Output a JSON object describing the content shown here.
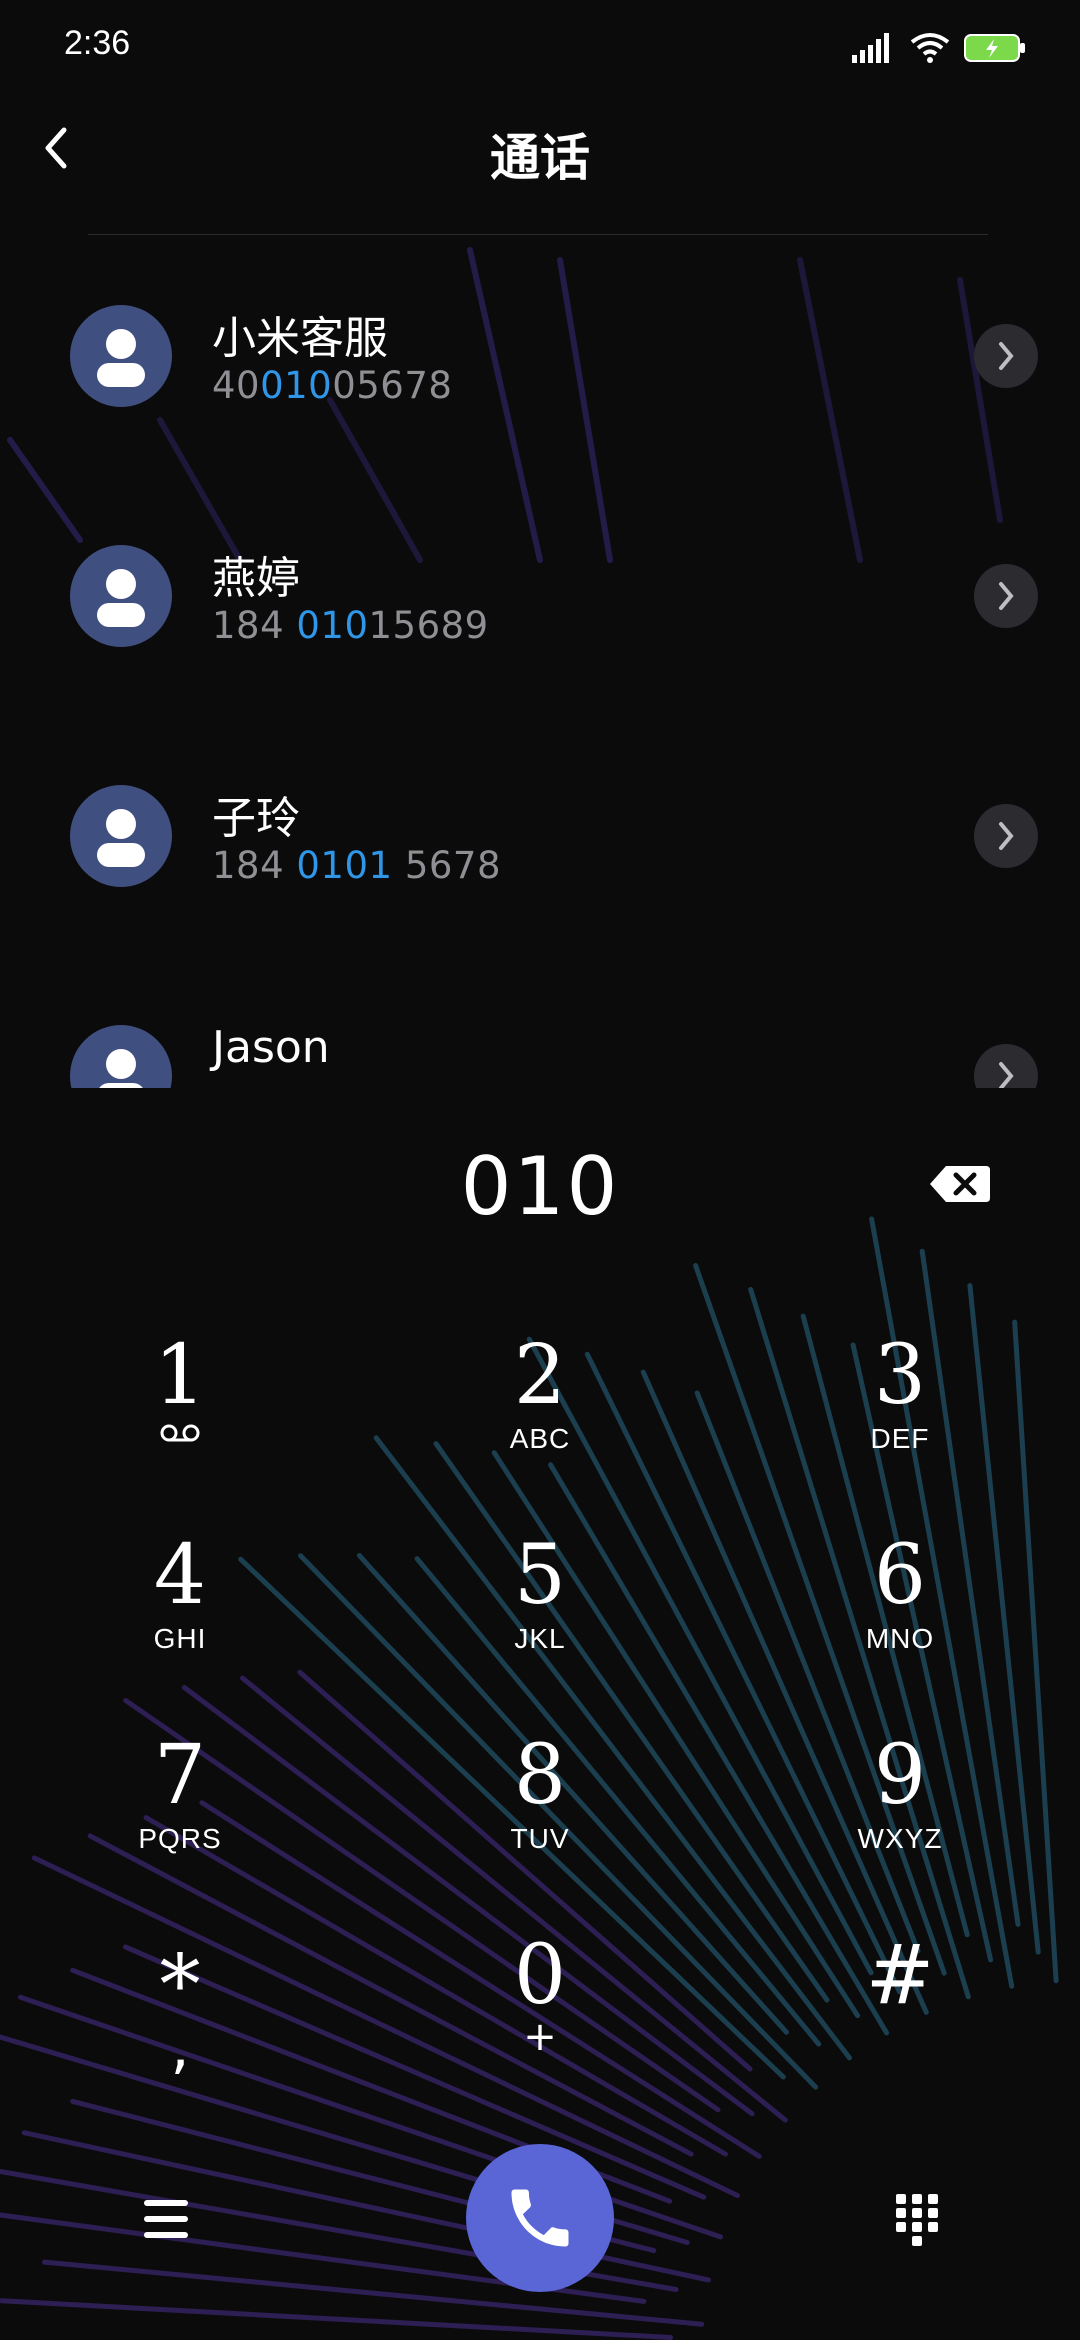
{
  "status_bar": {
    "time": "2:36"
  },
  "header": {
    "title": "通话"
  },
  "contacts": [
    {
      "name": "小米客服",
      "number_pre": "40",
      "number_match": "010",
      "number_post": "05678"
    },
    {
      "name": "燕婷",
      "number_pre": "184 ",
      "number_match": "010",
      "number_post": "15689"
    },
    {
      "name": "子玲",
      "number_pre": "184 ",
      "number_match": "0101",
      "number_post": " 5678"
    },
    {
      "name": "Jason",
      "number_pre": "",
      "number_match": "",
      "number_post": ""
    }
  ],
  "dial": {
    "input": "010"
  },
  "keypad": {
    "k1": {
      "digit": "1",
      "letters": ""
    },
    "k2": {
      "digit": "2",
      "letters": "ABC"
    },
    "k3": {
      "digit": "3",
      "letters": "DEF"
    },
    "k4": {
      "digit": "4",
      "letters": "GHI"
    },
    "k5": {
      "digit": "5",
      "letters": "JKL"
    },
    "k6": {
      "digit": "6",
      "letters": "MNO"
    },
    "k7": {
      "digit": "7",
      "letters": "PQRS"
    },
    "k8": {
      "digit": "8",
      "letters": "TUV"
    },
    "k9": {
      "digit": "9",
      "letters": "WXYZ"
    },
    "kstar": {
      "digit": "*",
      "letters": ","
    },
    "k0": {
      "digit": "0",
      "letters": "+"
    },
    "khash": {
      "digit": "#",
      "letters": ""
    }
  },
  "icons": {
    "back": "chevron-left-icon",
    "voicemail": "voicemail-icon",
    "backspace": "backspace-icon",
    "menu": "menu-icon",
    "call": "phone-icon",
    "dialpad": "dialpad-icon"
  },
  "colors": {
    "accent_match": "#2f96e8",
    "call_button": "#5a66d6",
    "avatar": "#3f4f80",
    "background": "#0b0b0c"
  }
}
